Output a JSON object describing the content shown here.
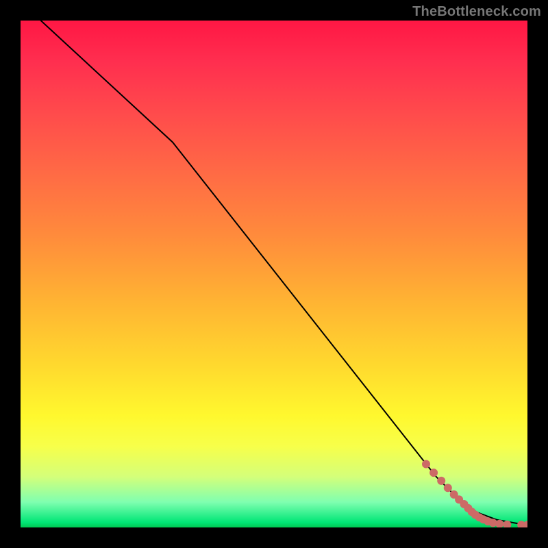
{
  "watermark": "TheBottleneck.com",
  "chart_data": {
    "type": "line",
    "title": "",
    "xlabel": "",
    "ylabel": "",
    "xlim": [
      0,
      100
    ],
    "ylim": [
      0,
      100
    ],
    "grid": false,
    "legend": false,
    "series": [
      {
        "name": "curve",
        "type": "line",
        "color": "#000000",
        "x": [
          4,
          30,
          82,
          86,
          90,
          94,
          98,
          100
        ],
        "y": [
          100,
          76,
          10,
          6,
          3,
          1.5,
          0.8,
          0.6
        ]
      },
      {
        "name": "points",
        "type": "scatter",
        "color": "#cc6a66",
        "marker_radius_px": 6,
        "x": [
          80,
          81.5,
          83,
          84.3,
          85.5,
          86.5,
          87.5,
          88.3,
          89,
          89.7,
          90.5,
          91.3,
          92.2,
          93.2,
          94.5,
          96,
          98.8,
          100
        ],
        "y": [
          12.5,
          10.8,
          9.2,
          7.8,
          6.5,
          5.5,
          4.6,
          3.8,
          3.1,
          2.5,
          2.0,
          1.6,
          1.2,
          0.9,
          0.7,
          0.55,
          0.5,
          0.5
        ]
      }
    ],
    "background_gradient_stops": [
      {
        "pos": 0.0,
        "color": "#ff1744"
      },
      {
        "pos": 0.3,
        "color": "#ff6a45"
      },
      {
        "pos": 0.68,
        "color": "#ffd92e"
      },
      {
        "pos": 0.9,
        "color": "#d4ff7a"
      },
      {
        "pos": 1.0,
        "color": "#00c853"
      }
    ]
  }
}
